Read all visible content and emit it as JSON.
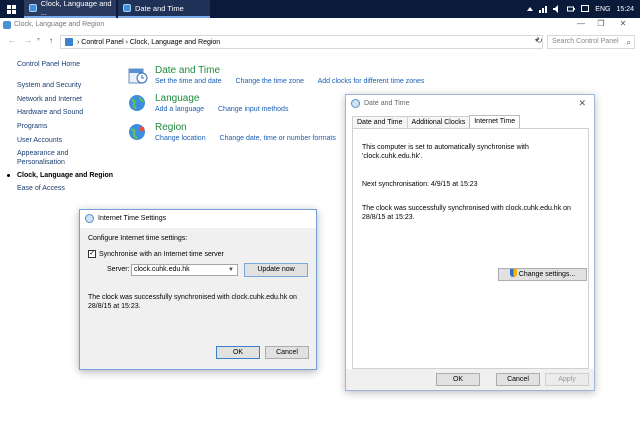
{
  "taskbar": {
    "tasks": [
      {
        "label": "Clock, Language and ..."
      },
      {
        "label": "Date and Time"
      }
    ],
    "tray": {
      "lang": "ENG",
      "time": "15:24"
    }
  },
  "window": {
    "title": "Clock, Language and Region",
    "minimize": "—",
    "maximize": "❐",
    "close": "✕"
  },
  "address": {
    "path": "›  Control Panel  ›  Clock, Language and Region",
    "search_placeholder": "Search Control Panel",
    "back": "←",
    "forward": "→",
    "up": "↑"
  },
  "sidebar": {
    "items": [
      {
        "label": "Control Panel Home"
      },
      {
        "label": "System and Security"
      },
      {
        "label": "Network and Internet"
      },
      {
        "label": "Hardware and Sound"
      },
      {
        "label": "Programs"
      },
      {
        "label": "User Accounts"
      },
      {
        "label": "Appearance and"
      },
      {
        "label": "Personalisation"
      },
      {
        "label": "Clock, Language and Region"
      },
      {
        "label": "Ease of Access"
      }
    ]
  },
  "categories": [
    {
      "title": "Date and Time",
      "links": [
        "Set the time and date",
        "Change the time zone",
        "Add clocks for different time zones"
      ]
    },
    {
      "title": "Language",
      "links": [
        "Add a language",
        "Change input methods"
      ]
    },
    {
      "title": "Region",
      "links": [
        "Change location",
        "Change date, time or number formats"
      ]
    }
  ],
  "date_time_dialog": {
    "title": "Date and Time",
    "tabs": [
      "Date and Time",
      "Additional Clocks",
      "Internet Time"
    ],
    "auto_sync_text": "This computer is set to automatically synchronise with 'clock.cuhk.edu.hk'.",
    "next_sync": "Next synchronisation: 4/9/15 at 15:23",
    "last_sync": "The clock was successfully synchronised with clock.cuhk.edu.hk on 28/8/15 at 15:23.",
    "change_settings": "Change settings...",
    "ok": "OK",
    "cancel": "Cancel",
    "apply": "Apply"
  },
  "internet_time_dialog": {
    "title": "Internet Time Settings",
    "configure_label": "Configure Internet time settings:",
    "sync_checkbox_label": "Synchronise with an Internet time server",
    "checkbox_mark": "✓",
    "server_label": "Server:",
    "server_value": "clock.cuhk.edu.hk",
    "update_now": "Update now",
    "status": "The clock was successfully synchronised with clock.cuhk.edu.hk on 28/8/15 at 15:23.",
    "ok": "OK",
    "cancel": "Cancel"
  }
}
